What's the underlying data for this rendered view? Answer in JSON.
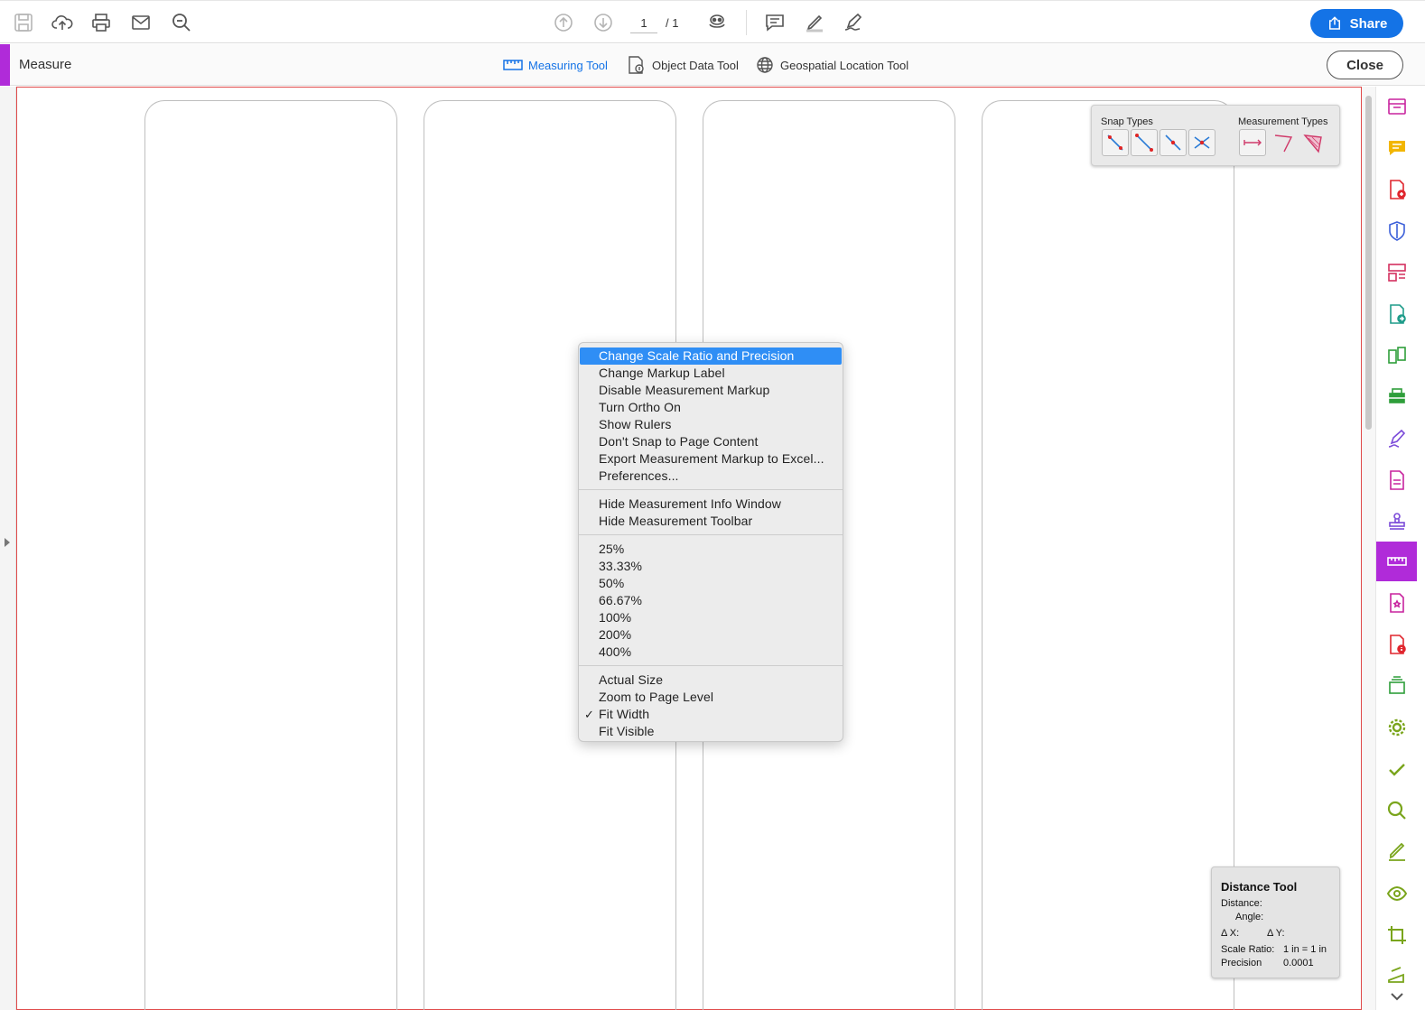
{
  "toolbar": {
    "page_current": "1",
    "page_total": "/ 1",
    "share_label": "Share"
  },
  "measurebar": {
    "title": "Measure",
    "tools": [
      "Measuring Tool",
      "Object Data Tool",
      "Geospatial Location Tool"
    ],
    "close_label": "Close"
  },
  "measpanel": {
    "snap_label": "Snap Types",
    "measure_label": "Measurement Types"
  },
  "context_menu": {
    "group1": [
      "Change Scale Ratio and Precision",
      "Change Markup Label",
      "Disable Measurement Markup",
      "Turn Ortho On",
      "Show Rulers",
      "Don't Snap to Page Content",
      "Export Measurement Markup to Excel...",
      "Preferences..."
    ],
    "group2": [
      "Hide Measurement Info Window",
      "Hide Measurement Toolbar"
    ],
    "group3": [
      "25%",
      "33.33%",
      "50%",
      "66.67%",
      "100%",
      "200%",
      "400%"
    ],
    "group4": [
      "Actual Size",
      "Zoom to Page Level",
      "Fit Width",
      "Fit Visible"
    ],
    "checkmark": "✓"
  },
  "distance_tool": {
    "title": "Distance Tool",
    "distance_label": "Distance:",
    "angle_label": "Angle:",
    "dx_label": "Δ X:",
    "dy_label": "Δ Y:",
    "scale_label": "Scale Ratio:",
    "scale_value": "1 in = 1 in",
    "precision_label": "Precision",
    "precision_value": "0.0001"
  },
  "colors": {
    "accent": "#b02bd9",
    "share": "#1473e6",
    "highlight": "#2f8ef5",
    "page_border": "#e04a4a"
  }
}
